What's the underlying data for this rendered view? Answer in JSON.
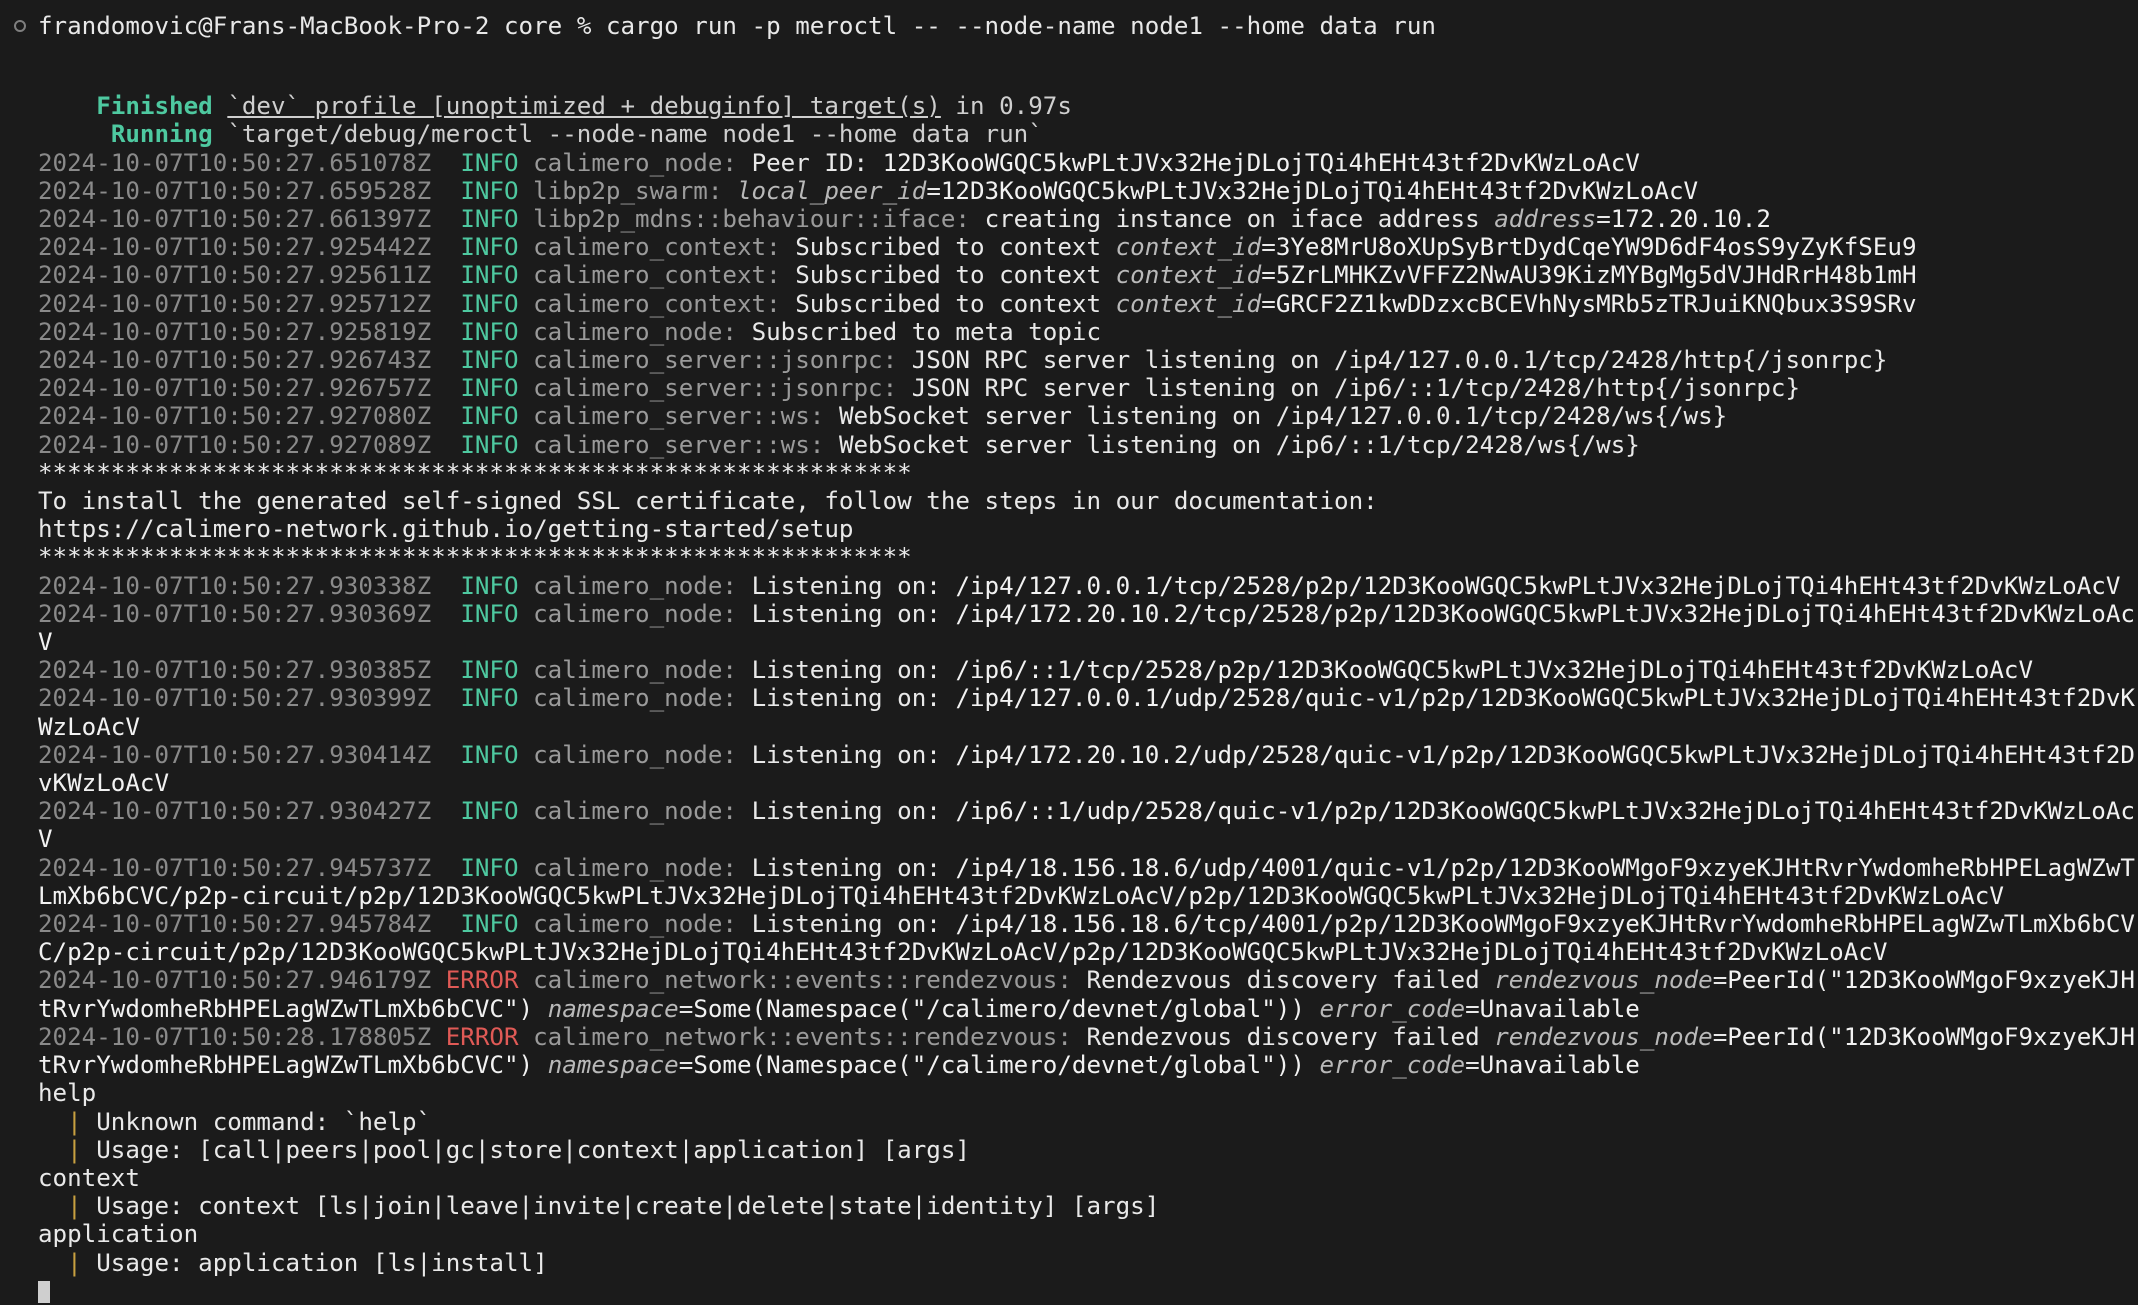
{
  "terminal": {
    "background": "#1b1b1b",
    "foreground": "#d6d6d6",
    "colors": {
      "timestamp": "#8a8a8a",
      "info": "#4ec9a0",
      "error": "#e05a56",
      "module": "#9a9a9a",
      "message": "#e9e9e9",
      "field_name": "#b9b9b9",
      "field_value": "#f2f2f2",
      "success_label": "#4ec9a0",
      "pipe_marker": "#c8a040"
    }
  },
  "prompt": {
    "dot_icon": "status-dot-icon",
    "user_host": "frandomovic@Frans-MacBook-Pro-2",
    "cwd": "core",
    "symbol": "%",
    "command": "cargo run -p meroctl -- --node-name node1 --home data run"
  },
  "cargo": {
    "finished_label": "Finished",
    "finished_text": "`dev` profile [unoptimized + debuginfo] target(s)",
    "finished_tail": " in 0.97s",
    "running_label": "Running",
    "running_text": "`target/debug/meroctl --node-name node1 --home data run`"
  },
  "ids": {
    "peer_id": "12D3KooWGQC5kwPLtJVx32HejDLojTQi4hEHt43tf2DvKWzLoAcV",
    "relay_peer_id": "12D3KooWMgoF9xzyeKJHtRvrYwdomheRbHPELagWZwTLmXb6bCVC",
    "iface_address": "172.20.10.2",
    "context_id_1": "3Ye8MrU8oXUpSyBrtDydCqeYW9D6dF4osS9yZyKfSEu9",
    "context_id_2": "5ZrLMHKZvVFFZ2NwAU39KizMYBgMg5dVJHdRrH48b1mH",
    "context_id_3": "GRCF2Z1kwDDzxcBCEVhNysMRb5zTRJuiKNQbux3S9SRv"
  },
  "logs": [
    {
      "ts": "2024-10-07T10:50:27.651078Z",
      "level": "INFO",
      "module": "calimero_node:",
      "msg": "Peer ID: ",
      "value": "12D3KooWGQC5kwPLtJVx32HejDLojTQi4hEHt43tf2DvKWzLoAcV"
    },
    {
      "ts": "2024-10-07T10:50:27.659528Z",
      "level": "INFO",
      "module": "libp2p_swarm:",
      "msg": "",
      "field": "local_peer_id",
      "value": "12D3KooWGQC5kwPLtJVx32HejDLojTQi4hEHt43tf2DvKWzLoAcV"
    },
    {
      "ts": "2024-10-07T10:50:27.661397Z",
      "level": "INFO",
      "module": "libp2p_mdns::behaviour::iface:",
      "msg": "creating instance on iface address ",
      "field": "address",
      "value": "172.20.10.2"
    },
    {
      "ts": "2024-10-07T10:50:27.925442Z",
      "level": "INFO",
      "module": "calimero_context:",
      "msg": "Subscribed to context ",
      "field": "context_id",
      "value": "3Ye8MrU8oXUpSyBrtDydCqeYW9D6dF4osS9yZyKfSEu9"
    },
    {
      "ts": "2024-10-07T10:50:27.925611Z",
      "level": "INFO",
      "module": "calimero_context:",
      "msg": "Subscribed to context ",
      "field": "context_id",
      "value": "5ZrLMHKZvVFFZ2NwAU39KizMYBgMg5dVJHdRrH48b1mH"
    },
    {
      "ts": "2024-10-07T10:50:27.925712Z",
      "level": "INFO",
      "module": "calimero_context:",
      "msg": "Subscribed to context ",
      "field": "context_id",
      "value": "GRCF2Z1kwDDzxcBCEVhNysMRb5zTRJuiKNQbux3S9SRv"
    },
    {
      "ts": "2024-10-07T10:50:27.925819Z",
      "level": "INFO",
      "module": "calimero_node:",
      "msg": "Subscribed to meta topic"
    },
    {
      "ts": "2024-10-07T10:50:27.926743Z",
      "level": "INFO",
      "module": "calimero_server::jsonrpc:",
      "msg": "JSON RPC server listening on /ip4/127.0.0.1/tcp/2428/http{/jsonrpc}"
    },
    {
      "ts": "2024-10-07T10:50:27.926757Z",
      "level": "INFO",
      "module": "calimero_server::jsonrpc:",
      "msg": "JSON RPC server listening on /ip6/::1/tcp/2428/http{/jsonrpc}"
    },
    {
      "ts": "2024-10-07T10:50:27.927080Z",
      "level": "INFO",
      "module": "calimero_server::ws:",
      "msg": "WebSocket server listening on /ip4/127.0.0.1/tcp/2428/ws{/ws}"
    },
    {
      "ts": "2024-10-07T10:50:27.927089Z",
      "level": "INFO",
      "module": "calimero_server::ws:",
      "msg": "WebSocket server listening on /ip6/::1/tcp/2428/ws{/ws}"
    }
  ],
  "ssl_notice": {
    "divider": "************************************************************",
    "text": "To install the generated self-signed SSL certificate, follow the steps in our documentation:",
    "url": "https://calimero-network.github.io/getting-started/setup"
  },
  "listening": [
    {
      "ts": "2024-10-07T10:50:27.930338Z",
      "level": "INFO",
      "module": "calimero_node:",
      "msg": "Listening on: ",
      "addr": "/ip4/127.0.0.1/tcp/2528/p2p/12D3KooWGQC5kwPLtJVx32HejDLojTQi4hEHt43tf2DvKWzLoAcV"
    },
    {
      "ts": "2024-10-07T10:50:27.930369Z",
      "level": "INFO",
      "module": "calimero_node:",
      "msg": "Listening on: ",
      "addr": "/ip4/172.20.10.2/tcp/2528/p2p/12D3KooWGQC5kwPLtJVx32HejDLojTQi4hEHt43tf2DvKWzLoAcV"
    },
    {
      "ts": "2024-10-07T10:50:27.930385Z",
      "level": "INFO",
      "module": "calimero_node:",
      "msg": "Listening on: ",
      "addr": "/ip6/::1/tcp/2528/p2p/12D3KooWGQC5kwPLtJVx32HejDLojTQi4hEHt43tf2DvKWzLoAcV"
    },
    {
      "ts": "2024-10-07T10:50:27.930399Z",
      "level": "INFO",
      "module": "calimero_node:",
      "msg": "Listening on: ",
      "addr": "/ip4/127.0.0.1/udp/2528/quic-v1/p2p/12D3KooWGQC5kwPLtJVx32HejDLojTQi4hEHt43tf2DvKWzLoAcV"
    },
    {
      "ts": "2024-10-07T10:50:27.930414Z",
      "level": "INFO",
      "module": "calimero_node:",
      "msg": "Listening on: ",
      "addr": "/ip4/172.20.10.2/udp/2528/quic-v1/p2p/12D3KooWGQC5kwPLtJVx32HejDLojTQi4hEHt43tf2DvKWzLoAcV"
    },
    {
      "ts": "2024-10-07T10:50:27.930427Z",
      "level": "INFO",
      "module": "calimero_node:",
      "msg": "Listening on: ",
      "addr": "/ip6/::1/udp/2528/quic-v1/p2p/12D3KooWGQC5kwPLtJVx32HejDLojTQi4hEHt43tf2DvKWzLoAcV"
    },
    {
      "ts": "2024-10-07T10:50:27.945737Z",
      "level": "INFO",
      "module": "calimero_node:",
      "msg": "Listening on: ",
      "addr": "/ip4/18.156.18.6/udp/4001/quic-v1/p2p/12D3KooWMgoF9xzyeKJHtRvrYwdomheRbHPELagWZwTLmXb6bCVC/p2p-circuit/p2p/12D3KooWGQC5kwPLtJVx32HejDLojTQi4hEHt43tf2DvKWzLoAcV/p2p/12D3KooWGQC5kwPLtJVx32HejDLojTQi4hEHt43tf2DvKWzLoAcV"
    },
    {
      "ts": "2024-10-07T10:50:27.945784Z",
      "level": "INFO",
      "module": "calimero_node:",
      "msg": "Listening on: ",
      "addr": "/ip4/18.156.18.6/tcp/4001/p2p/12D3KooWMgoF9xzyeKJHtRvrYwdomheRbHPELagWZwTLmXb6bCVC/p2p-circuit/p2p/12D3KooWGQC5kwPLtJVx32HejDLojTQi4hEHt43tf2DvKWzLoAcV/p2p/12D3KooWGQC5kwPLtJVx32HejDLojTQi4hEHt43tf2DvKWzLoAcV"
    }
  ],
  "errors": [
    {
      "ts": "2024-10-07T10:50:27.946179Z",
      "level": "ERROR",
      "module": "calimero_network::events::rendezvous:",
      "msg": "Rendezvous discovery failed ",
      "field1": "rendezvous_node",
      "val1": "PeerId(\"12D3KooWMgoF9xzyeKJHtRvrYwdomheRbHPELagWZwTLmXb6bCVC\")",
      "field2": "namespace",
      "val2": "Some(Namespace(\"/calimero/devnet/global\"))",
      "field3": "error_code",
      "val3": "Unavailable"
    },
    {
      "ts": "2024-10-07T10:50:28.178805Z",
      "level": "ERROR",
      "module": "calimero_network::events::rendezvous:",
      "msg": "Rendezvous discovery failed ",
      "field1": "rendezvous_node",
      "val1": "PeerId(\"12D3KooWMgoF9xzyeKJHtRvrYwdomheRbHPELagWZwTLmXb6bCVC\")",
      "field2": "namespace",
      "val2": "Some(Namespace(\"/calimero/devnet/global\"))",
      "field3": "error_code",
      "val3": "Unavailable"
    }
  ],
  "repl": [
    {
      "input": "help",
      "lines": [
        "Unknown command: `help`",
        "Usage: [call|peers|pool|gc|store|context|application] [args]"
      ]
    },
    {
      "input": "context",
      "lines": [
        "Usage: context [ls|join|leave|invite|create|delete|state|identity] [args]"
      ]
    },
    {
      "input": "application",
      "lines": [
        "Usage: application [ls|install]"
      ]
    }
  ],
  "cursor": {
    "visible": true
  }
}
